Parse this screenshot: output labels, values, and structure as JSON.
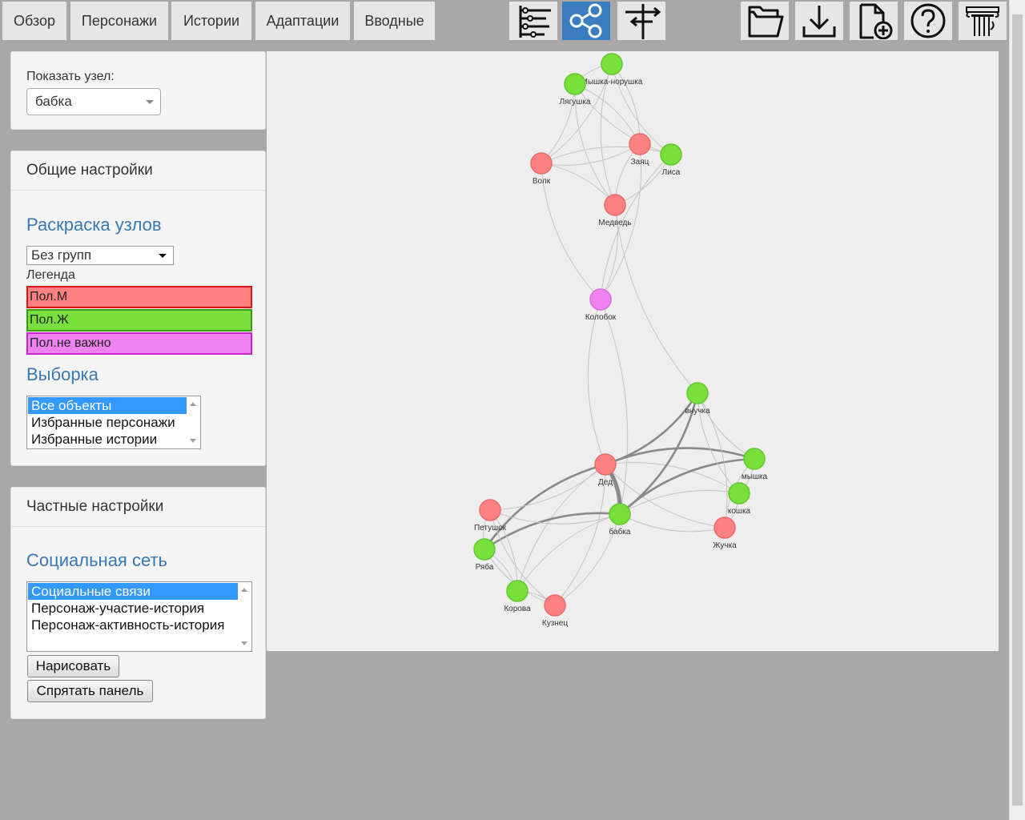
{
  "topnav": {
    "tabs": [
      {
        "label": "Обзор"
      },
      {
        "label": "Персонажи"
      },
      {
        "label": "Истории"
      },
      {
        "label": "Адаптации"
      },
      {
        "label": "Вводные"
      }
    ],
    "tool_icons": [
      "timeline-icon",
      "network-graph-icon",
      "signpost-icon"
    ],
    "tool_active": "network-graph-icon",
    "file_icons": [
      "folder-icon",
      "download-icon",
      "new-document-icon",
      "help-icon",
      "pillar-logo-icon"
    ]
  },
  "node_panel": {
    "label": "Показать узел:",
    "selected": "бабка"
  },
  "general_settings": {
    "header": "Общие настройки",
    "coloring_title": "Раскраска узлов",
    "grouping_selected": "Без групп",
    "legend_label": "Легенда",
    "legend": [
      {
        "label": "Пол.М",
        "color": "#fe8080",
        "border": "#e01414"
      },
      {
        "label": "Пол.Ж",
        "color": "#78e03c",
        "border": "#3a9a10"
      },
      {
        "label": "Пол.не важно",
        "color": "#ee82ee",
        "border": "#cc22cc"
      }
    ],
    "selection_title": "Выборка",
    "selection_options": [
      "Все объекты",
      "Избранные персонажи",
      "Избранные истории"
    ],
    "selection_selected": "Все объекты"
  },
  "private_settings": {
    "header": "Частные настройки",
    "network_title": "Социальная сеть",
    "network_options": [
      "Социальные связи",
      "Персонаж-участие-история",
      "Персонаж-активность-история"
    ],
    "network_selected": "Социальные связи",
    "draw_button": "Нарисовать",
    "hide_button": "Спрятать панель"
  },
  "graph": {
    "colors": {
      "male": "#fe8080",
      "female": "#78e03c",
      "any": "#ee82ee"
    },
    "nodes": [
      {
        "id": "mysh_nor",
        "label": "Мышка-норушка",
        "gender": "female"
      },
      {
        "id": "lyagushka",
        "label": "Лягушка",
        "gender": "female"
      },
      {
        "id": "zayac",
        "label": "Заяц",
        "gender": "male"
      },
      {
        "id": "lisa",
        "label": "Лиса",
        "gender": "female"
      },
      {
        "id": "volk",
        "label": "Волк",
        "gender": "male"
      },
      {
        "id": "medved",
        "label": "Медведь",
        "gender": "male"
      },
      {
        "id": "kolobok",
        "label": "Колобок",
        "gender": "any"
      },
      {
        "id": "vnuchka",
        "label": "внучка",
        "gender": "female"
      },
      {
        "id": "ded",
        "label": "Дед",
        "gender": "male"
      },
      {
        "id": "myshka",
        "label": "мышка",
        "gender": "female"
      },
      {
        "id": "koshka",
        "label": "кошка",
        "gender": "female"
      },
      {
        "id": "babka",
        "label": "бабка",
        "gender": "female"
      },
      {
        "id": "zhuchka",
        "label": "Жучка",
        "gender": "male"
      },
      {
        "id": "petushok",
        "label": "Петушок",
        "gender": "male"
      },
      {
        "id": "ryaba",
        "label": "Ряба",
        "gender": "female"
      },
      {
        "id": "korova",
        "label": "Корова",
        "gender": "female"
      },
      {
        "id": "kuznec",
        "label": "Кузнец",
        "gender": "male"
      }
    ],
    "edges": [
      {
        "source": "mysh_nor",
        "target": "lyagushka",
        "weight": 1
      },
      {
        "source": "mysh_nor",
        "target": "zayac",
        "weight": 1
      },
      {
        "source": "mysh_nor",
        "target": "lisa",
        "weight": 1
      },
      {
        "source": "mysh_nor",
        "target": "volk",
        "weight": 1
      },
      {
        "source": "mysh_nor",
        "target": "medved",
        "weight": 1
      },
      {
        "source": "lyagushka",
        "target": "zayac",
        "weight": 1
      },
      {
        "source": "lyagushka",
        "target": "lisa",
        "weight": 1
      },
      {
        "source": "lyagushka",
        "target": "volk",
        "weight": 1
      },
      {
        "source": "lyagushka",
        "target": "medved",
        "weight": 1
      },
      {
        "source": "zayac",
        "target": "volk",
        "weight": 1
      },
      {
        "source": "zayac",
        "target": "medved",
        "weight": 1
      },
      {
        "source": "lisa",
        "target": "medved",
        "weight": 1
      },
      {
        "source": "lisa",
        "target": "volk",
        "weight": 1
      },
      {
        "source": "volk",
        "target": "medved",
        "weight": 1
      },
      {
        "source": "kolobok",
        "target": "zayac",
        "weight": 1
      },
      {
        "source": "kolobok",
        "target": "volk",
        "weight": 1
      },
      {
        "source": "kolobok",
        "target": "medved",
        "weight": 1
      },
      {
        "source": "kolobok",
        "target": "lisa",
        "weight": 1
      },
      {
        "source": "kolobok",
        "target": "ded",
        "weight": 1
      },
      {
        "source": "kolobok",
        "target": "babka",
        "weight": 1
      },
      {
        "source": "medved",
        "target": "vnuchka",
        "weight": 1
      },
      {
        "source": "ded",
        "target": "babka",
        "weight": 4
      },
      {
        "source": "ded",
        "target": "vnuchka",
        "weight": 2
      },
      {
        "source": "ded",
        "target": "myshka",
        "weight": 2
      },
      {
        "source": "ded",
        "target": "ryaba",
        "weight": 2
      },
      {
        "source": "ded",
        "target": "koshka",
        "weight": 1
      },
      {
        "source": "ded",
        "target": "zhuchka",
        "weight": 1
      },
      {
        "source": "ded",
        "target": "petushok",
        "weight": 1
      },
      {
        "source": "ded",
        "target": "korova",
        "weight": 1
      },
      {
        "source": "ded",
        "target": "kuznec",
        "weight": 1
      },
      {
        "source": "babka",
        "target": "vnuchka",
        "weight": 2
      },
      {
        "source": "babka",
        "target": "myshka",
        "weight": 2
      },
      {
        "source": "babka",
        "target": "ryaba",
        "weight": 2
      },
      {
        "source": "babka",
        "target": "koshka",
        "weight": 1
      },
      {
        "source": "babka",
        "target": "zhuchka",
        "weight": 1
      },
      {
        "source": "babka",
        "target": "petushok",
        "weight": 1
      },
      {
        "source": "babka",
        "target": "korova",
        "weight": 1
      },
      {
        "source": "babka",
        "target": "kuznec",
        "weight": 1
      },
      {
        "source": "vnuchka",
        "target": "koshka",
        "weight": 1
      },
      {
        "source": "vnuchka",
        "target": "zhuchka",
        "weight": 1
      },
      {
        "source": "vnuchka",
        "target": "myshka",
        "weight": 1
      },
      {
        "source": "myshka",
        "target": "koshka",
        "weight": 1
      },
      {
        "source": "myshka",
        "target": "zhuchka",
        "weight": 1
      },
      {
        "source": "koshka",
        "target": "zhuchka",
        "weight": 1
      },
      {
        "source": "petushok",
        "target": "ryaba",
        "weight": 1
      },
      {
        "source": "petushok",
        "target": "korova",
        "weight": 1
      },
      {
        "source": "petushok",
        "target": "kuznec",
        "weight": 1
      },
      {
        "source": "ryaba",
        "target": "korova",
        "weight": 1
      },
      {
        "source": "ryaba",
        "target": "kuznec",
        "weight": 1
      },
      {
        "source": "korova",
        "target": "kuznec",
        "weight": 1
      }
    ]
  }
}
